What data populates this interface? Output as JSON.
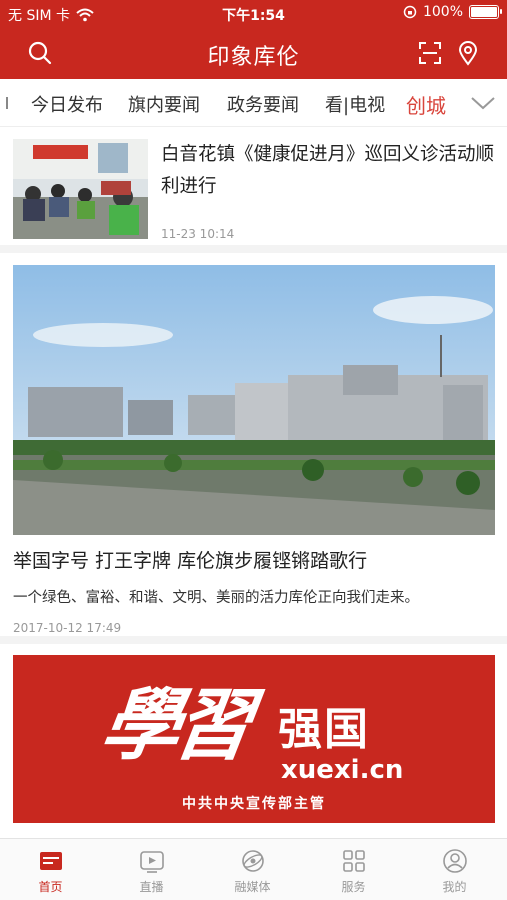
{
  "status": {
    "carrier": "无 SIM 卡",
    "time": "下午1:54",
    "battery_text": "100%",
    "battery_level": 1.0
  },
  "header": {
    "title": "印象库伦",
    "left_icon": "search-icon",
    "right_icons": [
      "scan-icon",
      "location-icon"
    ]
  },
  "tabs": {
    "items": [
      "今日发布",
      "旗内要闻",
      "政务要闻",
      "看|电视",
      "创城"
    ],
    "active_index": 4,
    "more_icon": "chevron-down-icon"
  },
  "articles": [
    {
      "title": "白音花镇《健康促进月》巡回义诊活动顺利进行",
      "date": "11-23 10:14"
    },
    {
      "title": "举国字号 打王字牌 库伦旗步履铿锵踏歌行",
      "desc": "一个绿色、富裕、和谐、文明、美丽的活力库伦正向我们走来。",
      "date": "2017-10-12 17:49"
    }
  ],
  "banner": {
    "calligraphy": "學習",
    "brand": "强国",
    "domain": "xuexi.cn",
    "sub": "中共中央宣传部主管"
  },
  "bottom_tabs": [
    {
      "label": "首页",
      "icon": "home-icon",
      "active": true
    },
    {
      "label": "直播",
      "icon": "live-play-icon",
      "active": false
    },
    {
      "label": "融媒体",
      "icon": "media-globe-icon",
      "active": false
    },
    {
      "label": "服务",
      "icon": "grid-services-icon",
      "active": false
    },
    {
      "label": "我的",
      "icon": "profile-icon",
      "active": false
    }
  ],
  "colors": {
    "brand_red": "#c8281f",
    "active_tab": "#d9453c",
    "muted": "#999999"
  }
}
